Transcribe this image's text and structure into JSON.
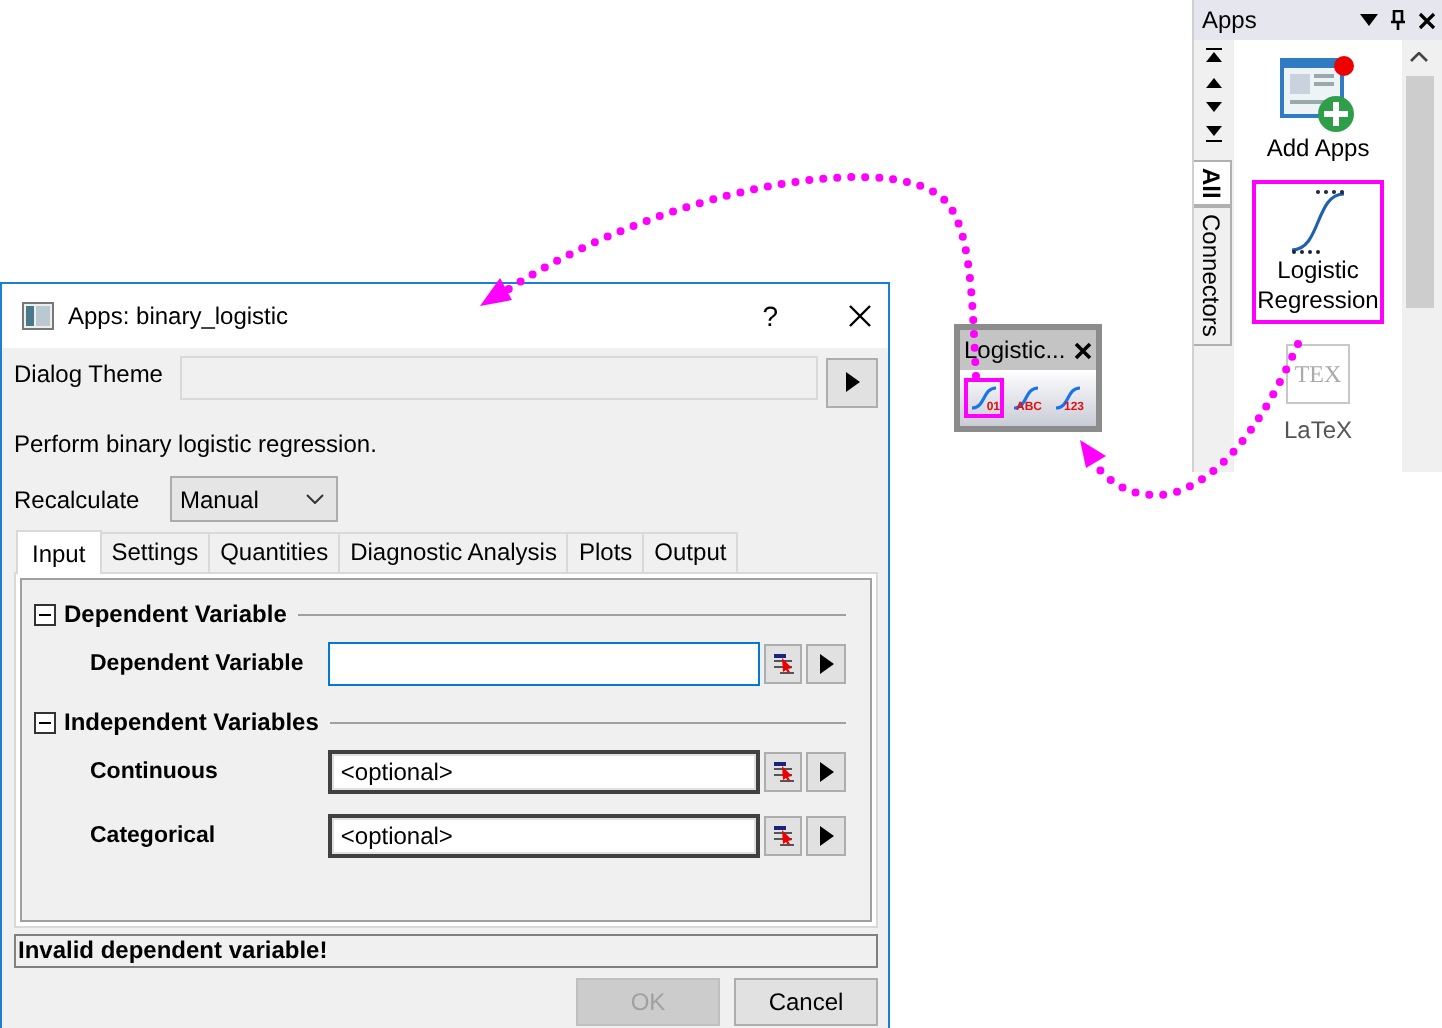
{
  "dialog": {
    "title": "Apps: binary_logistic",
    "help": "?",
    "theme": {
      "label": "Dialog Theme"
    },
    "description": "Perform binary logistic regression.",
    "recalculate": {
      "label": "Recalculate",
      "value": "Manual"
    },
    "tabs": [
      {
        "label": "Input",
        "selected": true
      },
      {
        "label": "Settings",
        "selected": false
      },
      {
        "label": "Quantities",
        "selected": false
      },
      {
        "label": "Diagnostic Analysis",
        "selected": false
      },
      {
        "label": "Plots",
        "selected": false
      },
      {
        "label": "Output",
        "selected": false
      }
    ],
    "groups": [
      {
        "title": "Dependent Variable",
        "expanded": true,
        "fields": [
          {
            "label": "Dependent Variable",
            "focused": true
          }
        ]
      },
      {
        "title": "Independent Variables",
        "expanded": true,
        "fields": [
          {
            "label": "Continuous",
            "value": "<optional>",
            "focused": false
          },
          {
            "label": "Categorical",
            "value": "<optional>",
            "focused": false
          }
        ]
      }
    ],
    "status": "Invalid dependent variable!",
    "buttons": [
      {
        "label": "OK",
        "disabled": true
      },
      {
        "label": "Cancel",
        "disabled": false
      }
    ]
  },
  "mini_toolbar": {
    "title": "Logistic...",
    "buttons": [
      {
        "caption": "01",
        "selected": true
      },
      {
        "caption": "ABC",
        "selected": false
      },
      {
        "caption": "123",
        "selected": false
      }
    ]
  },
  "apps_panel": {
    "title": "Apps",
    "side_tabs": [
      {
        "label": "All",
        "selected": true
      },
      {
        "label": "Connectors",
        "selected": false
      }
    ],
    "apps": [
      {
        "kind": "add",
        "name": "Add Apps",
        "selected": false
      },
      {
        "kind": "logistic",
        "name": "Logistic Regression",
        "selected": true
      },
      {
        "kind": "latex",
        "name": "LaTeX",
        "icon_text": "TEX",
        "selected": false
      }
    ]
  }
}
